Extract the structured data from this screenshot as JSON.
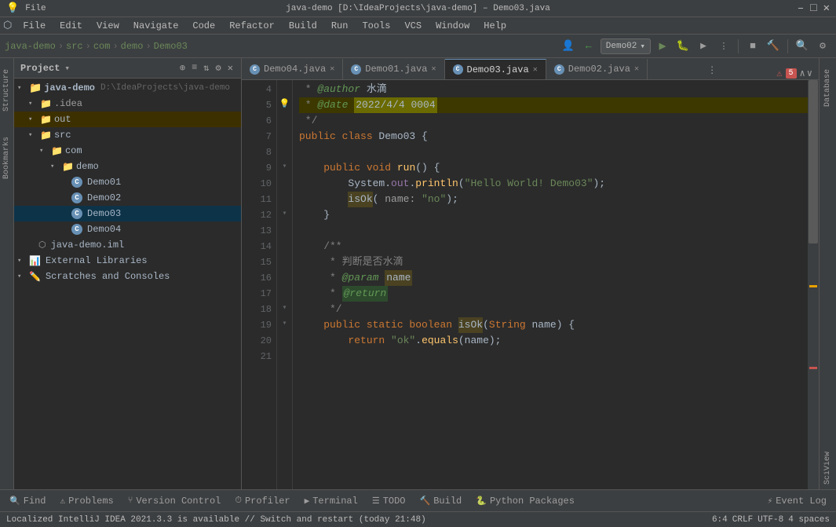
{
  "titlebar": {
    "title": "java-demo [D:\\IdeaProjects\\java-demo] – Demo03.java",
    "minimize": "–",
    "maximize": "□",
    "close": "✕"
  },
  "menubar": {
    "items": [
      "File",
      "Edit",
      "View",
      "Navigate",
      "Code",
      "Refactor",
      "Build",
      "Run",
      "Tools",
      "VCS",
      "Window",
      "Help"
    ]
  },
  "breadcrumb": {
    "parts": [
      "java-demo",
      "src",
      "com",
      "demo",
      "Demo03"
    ]
  },
  "runconfig": {
    "name": "Demo02",
    "dropdown": "▾"
  },
  "project": {
    "title": "Project",
    "tree": [
      {
        "indent": 0,
        "arrow": "▾",
        "type": "module",
        "label": "java-demo",
        "extra": "D:\\IdeaProjects\\java-demo"
      },
      {
        "indent": 1,
        "arrow": "▾",
        "type": "folder-hidden",
        "label": ".idea"
      },
      {
        "indent": 1,
        "arrow": "▾",
        "type": "folder-out",
        "label": "out"
      },
      {
        "indent": 1,
        "arrow": "▾",
        "type": "folder-src",
        "label": "src"
      },
      {
        "indent": 2,
        "arrow": "▾",
        "type": "folder",
        "label": "com"
      },
      {
        "indent": 3,
        "arrow": "▾",
        "type": "folder",
        "label": "demo"
      },
      {
        "indent": 4,
        "arrow": "",
        "type": "java",
        "label": "Demo01"
      },
      {
        "indent": 4,
        "arrow": "",
        "type": "java",
        "label": "Demo02"
      },
      {
        "indent": 4,
        "arrow": "",
        "type": "java",
        "label": "Demo03",
        "selected": true
      },
      {
        "indent": 4,
        "arrow": "",
        "type": "java",
        "label": "Demo04"
      },
      {
        "indent": 1,
        "arrow": "",
        "type": "iml",
        "label": "java-demo.iml"
      },
      {
        "indent": 0,
        "arrow": "▾",
        "type": "library",
        "label": "External Libraries"
      },
      {
        "indent": 0,
        "arrow": "▾",
        "type": "scratch",
        "label": "Scratches and Consoles"
      }
    ]
  },
  "tabs": [
    {
      "label": "Demo04.java",
      "active": false,
      "icon": "C"
    },
    {
      "label": "Demo01.java",
      "active": false,
      "icon": "C"
    },
    {
      "label": "Demo03.java",
      "active": true,
      "icon": "C"
    },
    {
      "label": "Demo02.java",
      "active": false,
      "icon": "C"
    }
  ],
  "code": {
    "lines": [
      {
        "num": 4,
        "fold": "",
        "lightbulb": false,
        "content": " * <span class='ann'>@author</span> <span class='ann-val'>水滴</span>"
      },
      {
        "num": 5,
        "fold": "",
        "lightbulb": true,
        "content": " * <span class='ann'>@date</span> <span class='ann-val'>2022/4/4 0004</span>"
      },
      {
        "num": 6,
        "fold": "",
        "lightbulb": false,
        "content": " */"
      },
      {
        "num": 7,
        "fold": "",
        "lightbulb": false,
        "content": "<span class='kw'>public class</span> <span class='type'>Demo03</span> {"
      },
      {
        "num": 8,
        "fold": "",
        "lightbulb": false,
        "content": ""
      },
      {
        "num": 9,
        "fold": "▾",
        "lightbulb": false,
        "content": "    <span class='kw'>public void</span> <span class='fn'>run</span>() {"
      },
      {
        "num": 10,
        "fold": "",
        "lightbulb": false,
        "content": "        <span class='type'>System</span>.<span class='ann-name'>out</span>.<span class='fn'>println</span>(<span class='str'>\"Hello World! Demo03\"</span>);"
      },
      {
        "num": 11,
        "fold": "",
        "lightbulb": false,
        "content": "        <span class='highlight-fn'>isOk</span>( name: <span class='str'>\"no\"</span>);"
      },
      {
        "num": 12,
        "fold": "▾",
        "lightbulb": false,
        "content": "    }"
      },
      {
        "num": 13,
        "fold": "",
        "lightbulb": false,
        "content": ""
      },
      {
        "num": 14,
        "fold": "",
        "lightbulb": false,
        "content": "    /**"
      },
      {
        "num": 15,
        "fold": "",
        "lightbulb": false,
        "content": "     * <span class='cmt'>判断是否水滴</span>"
      },
      {
        "num": 16,
        "fold": "",
        "lightbulb": false,
        "content": "     * <span class='param-tag'>@param</span> <span class='param-name'>name</span>"
      },
      {
        "num": 17,
        "fold": "",
        "lightbulb": false,
        "content": "     * <span class='ret-tag'>@return</span> <span class='ret-val'>&nbsp;&nbsp;&nbsp;&nbsp;&nbsp;</span>"
      },
      {
        "num": 18,
        "fold": "▾",
        "lightbulb": false,
        "content": "     */"
      },
      {
        "num": 19,
        "fold": "▾",
        "lightbulb": false,
        "content": "    <span class='kw'>public static boolean</span> <span class='highlight-fn'>isOk</span>(<span class='type'>String</span> name) {"
      },
      {
        "num": 20,
        "fold": "",
        "lightbulb": false,
        "content": "        <span class='kw'>return</span> <span class='str'>\"ok\"</span>.<span class='fn'>equals</span>(name);"
      },
      {
        "num": 21,
        "fold": "",
        "lightbulb": false,
        "content": ""
      }
    ]
  },
  "bottomtabs": [
    {
      "icon": "🔍",
      "label": "Find",
      "active": false
    },
    {
      "icon": "⚠",
      "label": "Problems",
      "active": false
    },
    {
      "icon": "⑂",
      "label": "Version Control",
      "active": false
    },
    {
      "icon": "⏱",
      "label": "Profiler",
      "active": false
    },
    {
      "icon": "▶",
      "label": "Terminal",
      "active": false
    },
    {
      "icon": "☰",
      "label": "TODO",
      "active": false
    },
    {
      "icon": "🔨",
      "label": "Build",
      "active": false
    },
    {
      "icon": "🐍",
      "label": "Python Packages",
      "active": false
    }
  ],
  "statusbar": {
    "message": "Localized IntelliJ IDEA 2021.3.3 is available // Switch and restart (today 21:48)",
    "position": "6:4",
    "lineend": "CRLF",
    "encoding": "UTF-8",
    "indent": "4 spaces",
    "event_log": "⚡ Event Log"
  },
  "errorbadge": "5",
  "rightpanels": [
    "Database",
    "SciView"
  ],
  "leftpanels": [
    "Structure",
    "Bookmarks"
  ]
}
